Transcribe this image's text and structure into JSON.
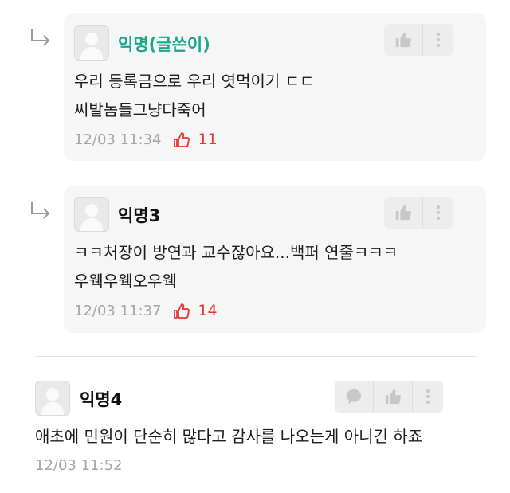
{
  "comments": [
    {
      "author": "익명(글쓴이)",
      "lines": [
        "우리 등록금으로 우리 엿먹이기 ㄷㄷ",
        "씨발놈들그냥다죽어"
      ],
      "time": "12/03 11:34",
      "likes": "11"
    },
    {
      "author": "익명3",
      "lines": [
        "ㅋㅋ처장이 방연과 교수잖아요...백퍼 연줄ㅋㅋㅋ",
        "우웩우웩오우웩"
      ],
      "time": "12/03 11:37",
      "likes": "14"
    },
    {
      "author": "익명4",
      "lines": [
        "애초에 민원이 단순히 많다고 감사를 나오는게 아니긴 하죠"
      ],
      "time": "12/03 11:52"
    }
  ],
  "icons": {
    "reply": "reply-arrow-icon",
    "like": "thumbs-up-icon",
    "more": "more-vertical-icon",
    "comment": "speech-bubble-icon",
    "heart": "heart-like-icon"
  },
  "colors": {
    "op_author": "#1aa88d",
    "likes": "#e5372b",
    "meta": "#a5a5a5",
    "card_bg": "#f6f6f6"
  }
}
